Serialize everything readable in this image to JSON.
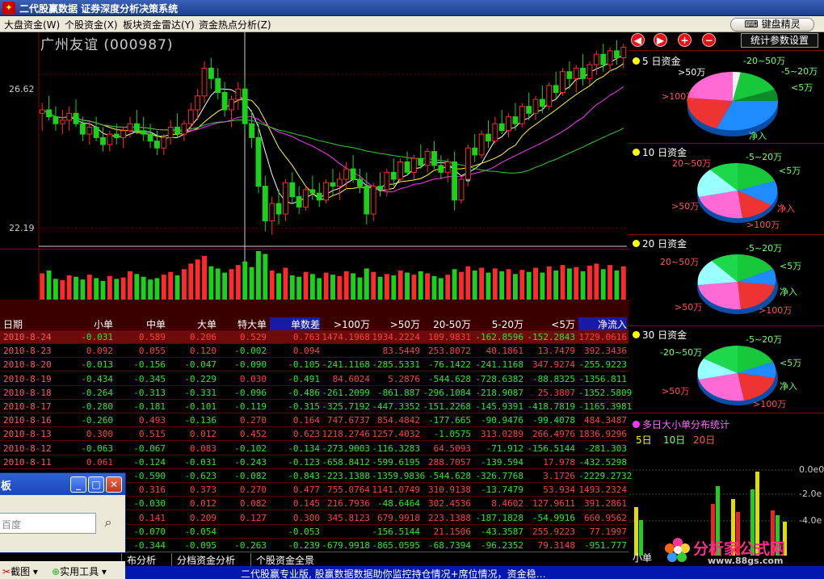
{
  "window": {
    "title": "二代股赢数据 证券深度分析决策系统"
  },
  "menu": [
    {
      "label": "大盘资金(W)"
    },
    {
      "label": "个股资金(X)"
    },
    {
      "label": "板块资金雷达(Y)"
    },
    {
      "label": "资金热点分析(Z)"
    }
  ],
  "wizard_button": "键盘精灵",
  "stock": {
    "name": "广州友谊",
    "code": "(000987)",
    "title_text": "广州友谊 (000987)"
  },
  "price_axis": {
    "high_label": "26.62",
    "low_label": "22.19"
  },
  "right_panel": {
    "stats_button": "统计参数设置",
    "nav_icons": [
      "arrow-left-icon",
      "arrow-right-icon",
      "plus-icon",
      "minus-icon"
    ],
    "pies": [
      {
        "days": "5",
        "title": "日资金",
        "labels": [
          "-20~50万",
          "-5~20万",
          ">50万",
          "<5万",
          ">100万",
          "净入"
        ]
      },
      {
        "days": "10",
        "title": "日资金",
        "labels": [
          "-5~20万",
          "20~50万",
          "<5万",
          ">50万",
          "净入",
          ">100万"
        ]
      },
      {
        "days": "20",
        "title": "日资金",
        "labels": [
          "-5~20万",
          "20~50万",
          "<5万",
          "净入",
          ">50万",
          ">100万"
        ]
      },
      {
        "days": "30",
        "title": "日资金",
        "labels": [
          "-5~20万",
          "-20~50万",
          "<5万",
          "净入",
          ">50万",
          ">100万"
        ]
      }
    ],
    "multi_day": {
      "title": "多日大小单分布统计",
      "tabs": [
        "5日",
        "10日",
        "20日"
      ],
      "y_labels": [
        "0.0e0",
        "-2.0e",
        "-4.0e"
      ],
      "bottom_label": "小单"
    }
  },
  "table": {
    "headers": [
      "日期",
      "小单",
      "中单",
      "大单",
      "特大单",
      "单数差",
      ">100万",
      ">50万",
      "20-50万",
      "5-20万",
      "<5万",
      "净流入"
    ],
    "rows": [
      [
        "2010-8-24",
        "-0.031",
        "0.589",
        "0.206",
        "0.529",
        "0.763",
        "1474.1968",
        "1934.2224",
        "109.9831",
        "-162.8596",
        "-152.2843",
        "1729.0616"
      ],
      [
        "2010-8-23",
        "0.092",
        "0.055",
        "0.120",
        "-0.002",
        "0.094",
        "",
        "83.5449",
        "253.8072",
        "40.1861",
        "13.7479",
        "392.3436"
      ],
      [
        "2010-8-20",
        "-0.013",
        "-0.156",
        "-0.047",
        "-0.090",
        "-0.105",
        "-241.1168",
        "-285.5331",
        "-76.1422",
        "-241.1168",
        "347.9274",
        "-255.9223"
      ],
      [
        "2010-8-19",
        "-0.434",
        "-0.345",
        "-0.229",
        "0.030",
        "-0.491",
        "84.6024",
        "5.2876",
        "-544.628",
        "-728.6382",
        "-88.8325",
        "-1356.811"
      ],
      [
        "2010-8-18",
        "-0.264",
        "-0.313",
        "-0.331",
        "-0.096",
        "-0.486",
        "-261.2099",
        "-861.887",
        "-296.1084",
        "-218.9087",
        "25.3807",
        "-1352.5809"
      ],
      [
        "2010-8-17",
        "-0.280",
        "-0.181",
        "-0.101",
        "-0.119",
        "-0.315",
        "-325.7192",
        "-447.3352",
        "-151.2268",
        "-145.9391",
        "-418.7819",
        "-1165.3981"
      ],
      [
        "2010-8-16",
        "-0.260",
        "0.493",
        "-0.136",
        "0.270",
        "0.164",
        "747.6737",
        "854.4842",
        "-177.665",
        "-90.9476",
        "-99.4078",
        "484.3487"
      ],
      [
        "2010-8-13",
        "0.300",
        "0.515",
        "0.012",
        "0.452",
        "0.623",
        "1218.2746",
        "1257.4032",
        "-1.0575",
        "313.0289",
        "266.4976",
        "1836.9296"
      ],
      [
        "2010-8-12",
        "-0.063",
        "-0.067",
        "0.083",
        "-0.102",
        "-0.134",
        "-273.9003",
        "-116.3283",
        "64.5093",
        "-71.912",
        "-156.5144",
        "-281.303"
      ],
      [
        "2010-8-11",
        "0.061",
        "-0.124",
        "-0.031",
        "-0.243",
        "-0.123",
        "-658.8412",
        "-599.6195",
        "288.7057",
        "-139.594",
        "17.978",
        "-432.5298"
      ],
      [
        "",
        "",
        "-0.590",
        "-0.623",
        "-0.082",
        "-0.843",
        "-223.1388",
        "-1359.9836",
        "-544.628",
        "-326.7768",
        "3.1726",
        "-2229.2732"
      ],
      [
        "",
        "",
        "0.316",
        "0.373",
        "0.270",
        "0.477",
        "755.0764",
        "1141.0749",
        "310.9138",
        "-13.7479",
        "53.934",
        "1493.2324"
      ],
      [
        "",
        "",
        "-0.030",
        "0.012",
        "0.082",
        "0.145",
        "216.7936",
        "-48.6464",
        "302.4536",
        "8.4602",
        "127.9611",
        "391.2861"
      ],
      [
        "",
        "",
        "0.141",
        "0.209",
        "0.127",
        "0.300",
        "345.8123",
        "679.9918",
        "223.1388",
        "-187.1828",
        "-54.9916",
        "660.9562"
      ],
      [
        "",
        "",
        "-0.070",
        "-0.054",
        "",
        "-0.053",
        "",
        "-156.5144",
        "21.1506",
        "-43.3587",
        "255.9223",
        "77.1997"
      ],
      [
        "",
        "",
        "-0.344",
        "-0.095",
        "-0.263",
        "-0.239",
        "-679.9918",
        "-865.0595",
        "-68.7394",
        "-96.2352",
        "79.3148",
        "-951.777"
      ]
    ]
  },
  "bottom_tabs": [
    "布分析",
    "分档资金分析",
    "个股资金全景"
  ],
  "status_text": "二代股赢专业版, 股赢数据数据助你监控持仓情况+席位情况，资金稳…",
  "xp_window": {
    "title": "板",
    "search_placeholder": "百度",
    "taskbar_items": [
      "截图",
      "实用工具"
    ]
  },
  "watermark": {
    "text": "分析家公式网",
    "url": "www.88gs.com"
  },
  "colors": {
    "up": "#ff2a2a",
    "down": "#19d219",
    "ma5": "#ffffff",
    "ma10": "#ffff33",
    "ma20": "#ff33ff",
    "ma60": "#33cc33"
  },
  "chart_data": {
    "type": "candlestick",
    "ylim": [
      21.6,
      27.6
    ],
    "y_ticks": [
      26.62,
      22.19
    ],
    "ohlc": [
      [
        25.5,
        25.8,
        25.0,
        25.6
      ],
      [
        25.6,
        26.0,
        25.3,
        25.4
      ],
      [
        25.4,
        25.7,
        25.0,
        25.2
      ],
      [
        25.2,
        25.6,
        24.9,
        25.3
      ],
      [
        25.3,
        25.7,
        25.0,
        25.5
      ],
      [
        25.5,
        25.9,
        25.1,
        25.2
      ],
      [
        25.2,
        25.4,
        24.7,
        24.9
      ],
      [
        24.9,
        25.3,
        24.6,
        25.1
      ],
      [
        25.1,
        25.4,
        24.7,
        24.8
      ],
      [
        24.8,
        25.1,
        24.4,
        24.6
      ],
      [
        24.6,
        25.0,
        24.4,
        24.9
      ],
      [
        24.9,
        25.2,
        24.6,
        24.8
      ],
      [
        24.8,
        25.1,
        24.5,
        25.0
      ],
      [
        25.0,
        25.4,
        24.8,
        25.2
      ],
      [
        25.2,
        25.6,
        24.9,
        25.0
      ],
      [
        25.0,
        25.4,
        24.7,
        24.9
      ],
      [
        24.9,
        25.2,
        24.5,
        24.7
      ],
      [
        24.7,
        25.0,
        24.3,
        24.5
      ],
      [
        24.5,
        24.9,
        24.3,
        24.8
      ],
      [
        24.8,
        25.3,
        24.6,
        25.1
      ],
      [
        25.1,
        25.5,
        24.8,
        24.9
      ],
      [
        24.9,
        25.3,
        24.7,
        25.2
      ],
      [
        25.2,
        25.8,
        25.0,
        25.6
      ],
      [
        25.6,
        26.2,
        25.3,
        26.0
      ],
      [
        26.0,
        27.0,
        25.8,
        26.8
      ],
      [
        26.8,
        27.1,
        26.2,
        26.5
      ],
      [
        26.5,
        26.8,
        25.9,
        26.1
      ],
      [
        26.1,
        26.4,
        25.4,
        25.6
      ],
      [
        25.6,
        26.0,
        25.1,
        25.9
      ],
      [
        25.9,
        26.4,
        25.6,
        26.2
      ],
      [
        26.2,
        26.5,
        25.0,
        25.2
      ],
      [
        25.2,
        25.6,
        24.5,
        24.8
      ],
      [
        24.8,
        25.2,
        23.2,
        23.4
      ],
      [
        23.4,
        23.7,
        22.1,
        22.4
      ],
      [
        22.4,
        23.1,
        22.0,
        22.9
      ],
      [
        22.9,
        23.3,
        22.3,
        22.6
      ],
      [
        22.6,
        23.6,
        22.4,
        23.5
      ],
      [
        23.5,
        23.8,
        22.9,
        23.1
      ],
      [
        23.1,
        23.4,
        22.6,
        22.8
      ],
      [
        22.8,
        23.4,
        22.7,
        23.3
      ],
      [
        23.3,
        23.7,
        23.0,
        23.2
      ],
      [
        23.2,
        23.5,
        22.8,
        23.0
      ],
      [
        23.0,
        23.6,
        22.9,
        23.5
      ],
      [
        23.5,
        23.9,
        23.1,
        23.4
      ],
      [
        23.4,
        23.8,
        23.0,
        23.6
      ],
      [
        23.6,
        24.1,
        23.3,
        23.9
      ],
      [
        23.9,
        24.3,
        23.5,
        23.6
      ],
      [
        23.6,
        23.9,
        23.2,
        23.4
      ],
      [
        23.4,
        23.8,
        22.3,
        22.6
      ],
      [
        22.6,
        23.5,
        22.4,
        23.4
      ],
      [
        23.4,
        23.8,
        23.1,
        23.3
      ],
      [
        23.3,
        23.9,
        23.1,
        23.8
      ],
      [
        23.8,
        24.2,
        23.4,
        23.6
      ],
      [
        23.6,
        24.2,
        23.5,
        24.1
      ],
      [
        24.1,
        24.4,
        23.7,
        23.8
      ],
      [
        23.8,
        24.3,
        23.6,
        24.2
      ],
      [
        24.2,
        24.6,
        23.9,
        24.0
      ],
      [
        24.0,
        24.5,
        23.8,
        24.4
      ],
      [
        24.4,
        24.7,
        23.9,
        24.0
      ],
      [
        24.0,
        24.3,
        23.6,
        23.8
      ],
      [
        23.8,
        24.2,
        23.5,
        24.1
      ],
      [
        24.1,
        24.4,
        22.7,
        23.0
      ],
      [
        23.0,
        23.7,
        22.9,
        23.6
      ],
      [
        23.6,
        24.6,
        23.4,
        24.5
      ],
      [
        24.5,
        24.9,
        24.1,
        24.3
      ],
      [
        24.3,
        25.0,
        24.2,
        24.9
      ],
      [
        24.9,
        25.3,
        24.5,
        24.7
      ],
      [
        24.7,
        25.4,
        24.6,
        25.2
      ],
      [
        25.2,
        25.6,
        24.9,
        25.0
      ],
      [
        25.0,
        25.5,
        24.8,
        25.4
      ],
      [
        25.4,
        25.8,
        25.0,
        25.2
      ],
      [
        25.2,
        25.8,
        25.1,
        25.7
      ],
      [
        25.7,
        26.1,
        25.3,
        25.5
      ],
      [
        25.5,
        26.0,
        25.3,
        25.9
      ],
      [
        25.9,
        26.3,
        25.5,
        25.7
      ],
      [
        25.7,
        26.4,
        25.6,
        26.3
      ],
      [
        26.3,
        26.7,
        25.9,
        26.1
      ],
      [
        26.1,
        26.8,
        26.0,
        26.7
      ],
      [
        26.7,
        27.0,
        26.2,
        26.5
      ],
      [
        26.5,
        26.9,
        26.1,
        26.8
      ],
      [
        26.8,
        27.2,
        26.3,
        26.5
      ],
      [
        26.5,
        27.0,
        26.3,
        26.9
      ],
      [
        26.9,
        27.3,
        26.6,
        27.2
      ],
      [
        27.2,
        27.5,
        26.7,
        26.9
      ],
      [
        26.9,
        27.4,
        26.7,
        27.3
      ],
      [
        27.3,
        27.6,
        26.9,
        27.1
      ],
      [
        27.1,
        27.5,
        26.8,
        27.4
      ]
    ],
    "volume": [
      38,
      42,
      30,
      28,
      35,
      33,
      29,
      36,
      31,
      27,
      34,
      30,
      32,
      41,
      37,
      33,
      29,
      31,
      36,
      40,
      35,
      44,
      52,
      58,
      63,
      48,
      45,
      39,
      44,
      50,
      55,
      47,
      70,
      66,
      42,
      38,
      46,
      35,
      33,
      40,
      37,
      31,
      39,
      36,
      34,
      41,
      38,
      32,
      45,
      40,
      33,
      37,
      35,
      42,
      39,
      36,
      41,
      38,
      34,
      31,
      36,
      44,
      40,
      48,
      42,
      46,
      39,
      45,
      41,
      44,
      37,
      43,
      40,
      46,
      39,
      48,
      42,
      50,
      45,
      47,
      41,
      49,
      52,
      44,
      50,
      42,
      48
    ]
  }
}
